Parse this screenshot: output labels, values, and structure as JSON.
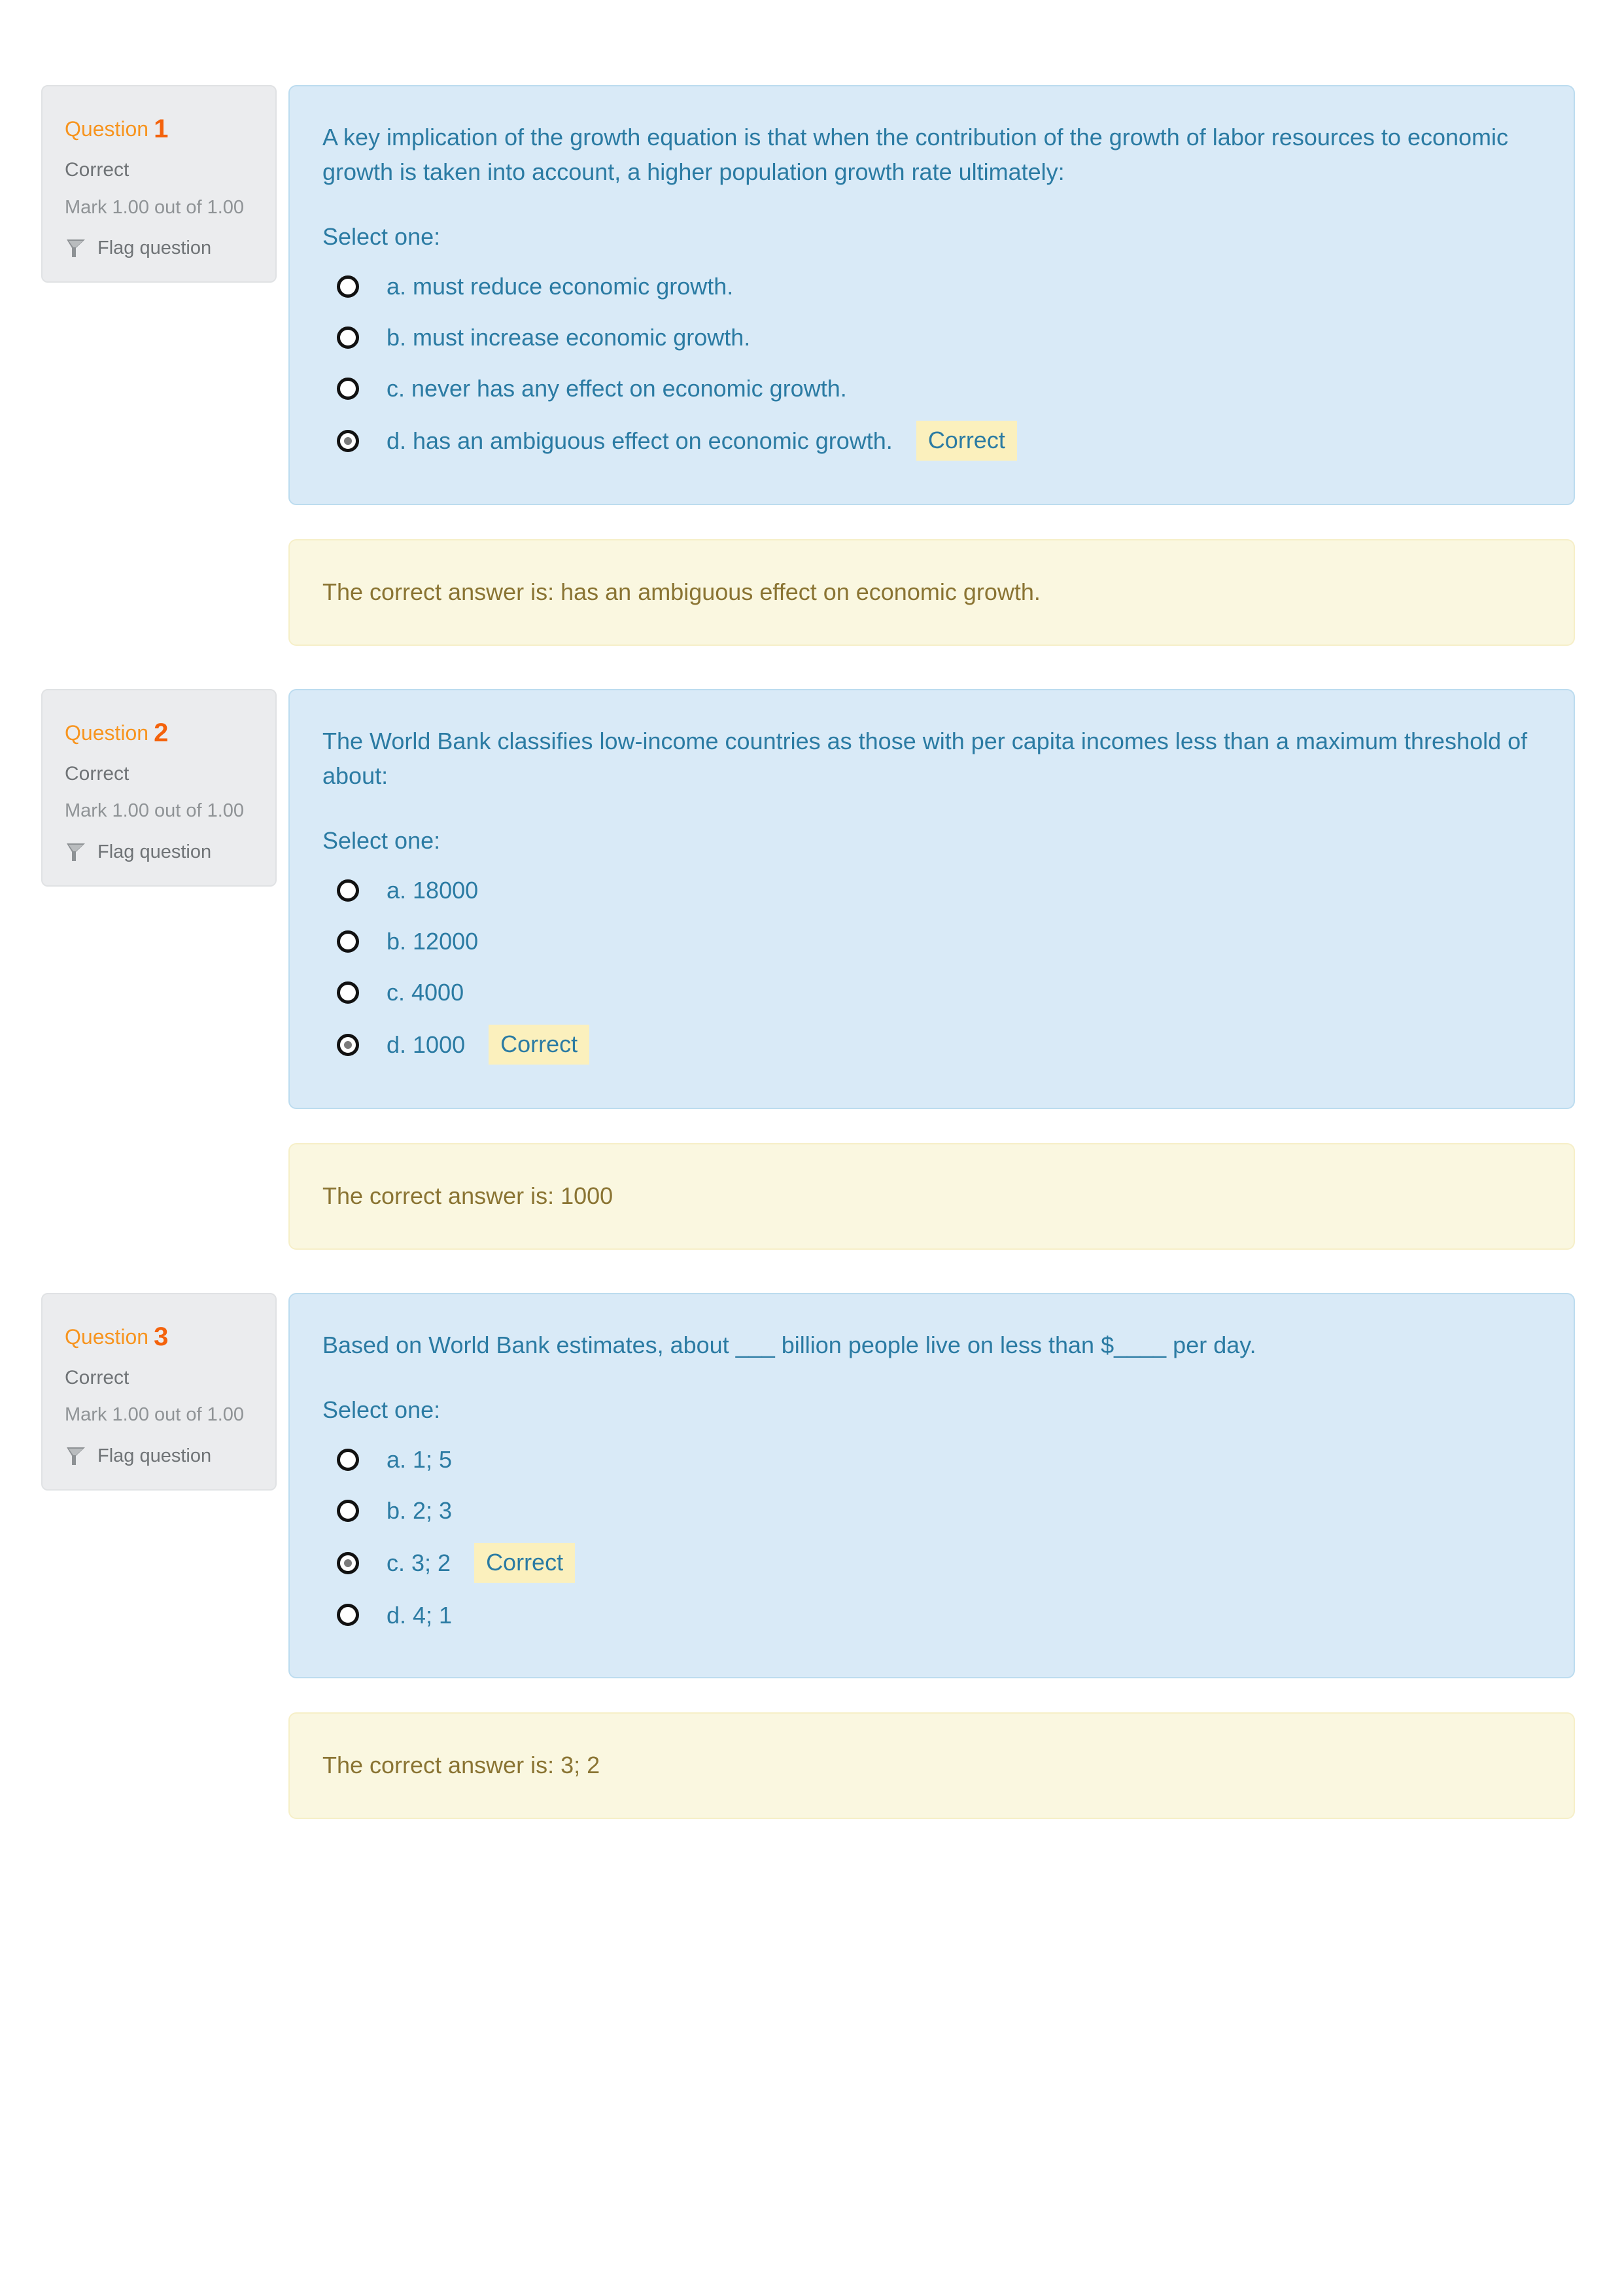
{
  "colors": {
    "page_background": "#ffffff",
    "info_panel_background": "#ebecee",
    "question_panel_background": "#d9eaf7",
    "question_text": "#2b7ba3",
    "question_number_accent": "#f4620b",
    "question_word_accent": "#f7941e",
    "feedback_background": "#faf7e0",
    "feedback_text": "#8a7433",
    "correct_badge_background": "#fbf0bd"
  },
  "labels": {
    "question_word": "Question",
    "flag_question": "Flag question",
    "select_one": "Select one:",
    "correct_badge": "Correct",
    "flag_icon_name": "flag-icon"
  },
  "questions": [
    {
      "number": "1",
      "state": "Correct",
      "grade": "Mark 1.00 out of 1.00",
      "flag_label": "Flag question",
      "text": "A key implication of the growth equation is that when the contribution of the growth of labor resources to economic growth is taken into account, a higher population growth rate ultimately:",
      "select_one": "Select one:",
      "options": [
        {
          "label": "a. must reduce economic growth.",
          "selected": false,
          "badge": ""
        },
        {
          "label": "b. must increase economic growth.",
          "selected": false,
          "badge": ""
        },
        {
          "label": "c. never has any effect on economic growth.",
          "selected": false,
          "badge": ""
        },
        {
          "label": "d. has an ambiguous effect on economic growth.",
          "selected": true,
          "badge": "Correct"
        }
      ],
      "feedback": "The correct answer is: has an ambiguous effect on economic growth."
    },
    {
      "number": "2",
      "state": "Correct",
      "grade": "Mark 1.00 out of 1.00",
      "flag_label": "Flag question",
      "text": "The World Bank classifies low-income countries as those with per capita incomes less than a maximum threshold of about:",
      "select_one": "Select one:",
      "options": [
        {
          "label": "a. 18000",
          "selected": false,
          "badge": ""
        },
        {
          "label": "b. 12000",
          "selected": false,
          "badge": ""
        },
        {
          "label": "c. 4000",
          "selected": false,
          "badge": ""
        },
        {
          "label": "d. 1000",
          "selected": true,
          "badge": "Correct"
        }
      ],
      "feedback": "The correct answer is: 1000"
    },
    {
      "number": "3",
      "state": "Correct",
      "grade": "Mark 1.00 out of 1.00",
      "flag_label": "Flag question",
      "text": "Based on World Bank estimates, about ___ billion people live on less than $____ per day.",
      "select_one": "Select one:",
      "options": [
        {
          "label": "a. 1; 5",
          "selected": false,
          "badge": ""
        },
        {
          "label": "b. 2; 3",
          "selected": false,
          "badge": ""
        },
        {
          "label": "c. 3; 2",
          "selected": true,
          "badge": "Correct"
        },
        {
          "label": "d. 4; 1",
          "selected": false,
          "badge": ""
        }
      ],
      "feedback": "The correct answer is: 3; 2"
    }
  ]
}
